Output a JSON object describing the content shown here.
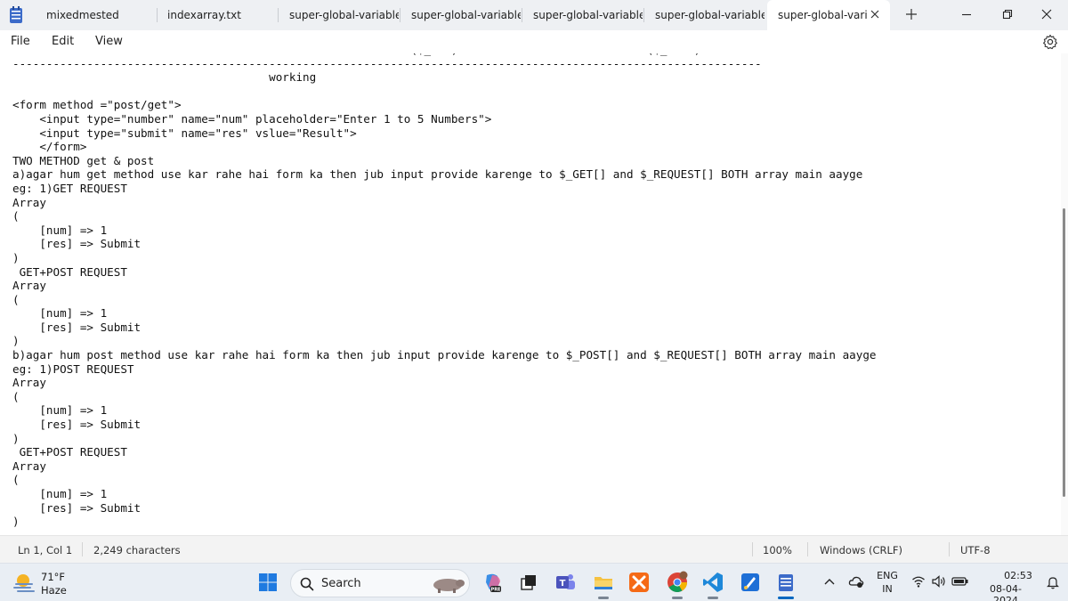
{
  "tabs": [
    {
      "label": "mixedmested"
    },
    {
      "label": "indexarray.txt"
    },
    {
      "label": "super-global-variable"
    },
    {
      "label": "super-global-variable"
    },
    {
      "label": "super-global-variable"
    },
    {
      "label": "super-global-variable"
    },
    {
      "label": "super-global-vari"
    }
  ],
  "menu": {
    "file": "File",
    "edit": "Edit",
    "view": "View"
  },
  "editor": {
    "lines": [
      "SO ACCORDING TO FORM CONDITION JUB GET METHOD DIYA HOGA TO ($_GET) & POST METHOD DIYA HOGA TO ($_POST).",
      "---------------------------------------------------------------------------------------------------------------",
      "                                      working",
      "",
      "<form method =\"post/get\">",
      "    <input type=\"number\" name=\"num\" placeholder=\"Enter 1 to 5 Numbers\">",
      "    <input type=\"submit\" name=\"res\" vslue=\"Result\">",
      "    </form>",
      "TWO METHOD get & post",
      "a)agar hum get method use kar rahe hai form ka then jub input provide karenge to $_GET[] and $_REQUEST[] BOTH array main aayge",
      "eg: 1)GET REQUEST",
      "Array",
      "(",
      "    [num] => 1",
      "    [res] => Submit",
      ")",
      " GET+POST REQUEST",
      "Array",
      "(",
      "    [num] => 1",
      "    [res] => Submit",
      ")",
      "b)agar hum post method use kar rahe hai form ka then jub input provide karenge to $_POST[] and $_REQUEST[] BOTH array main aayge",
      "eg: 1)POST REQUEST",
      "Array",
      "(",
      "    [num] => 1",
      "    [res] => Submit",
      ")",
      " GET+POST REQUEST",
      "Array",
      "(",
      "    [num] => 1",
      "    [res] => Submit",
      ")"
    ]
  },
  "status": {
    "position": "Ln 1, Col 1",
    "characters": "2,249 characters",
    "zoom": "100%",
    "line_ending": "Windows (CRLF)",
    "encoding": "UTF-8"
  },
  "taskbar": {
    "weather_temp": "71°F",
    "weather_cond": "Haze",
    "search": "Search",
    "lang_top": "ENG",
    "lang_bottom": "IN",
    "time": "02:53",
    "date": "08-04-2024"
  },
  "colors": {
    "accent": "#0067c0",
    "taskbar": "#e9eef4",
    "tabbar": "#eef0f3"
  }
}
